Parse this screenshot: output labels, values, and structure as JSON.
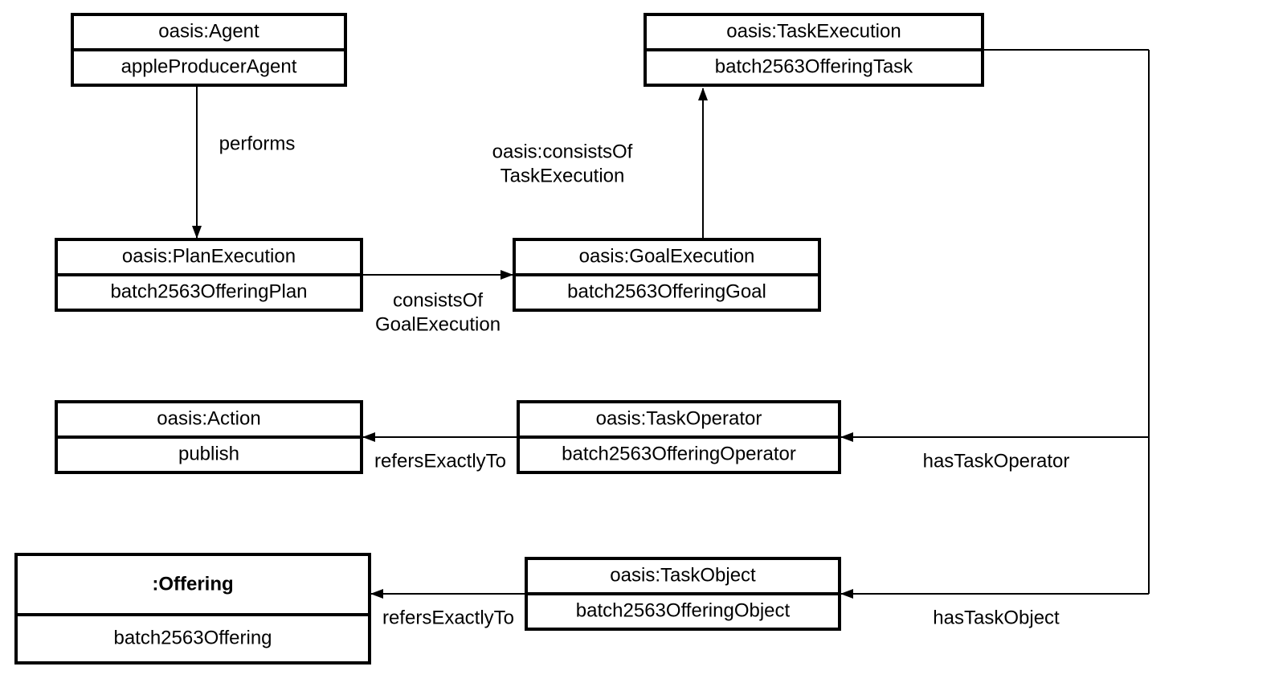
{
  "nodes": {
    "agent": {
      "header": "oasis:Agent",
      "value": "appleProducerAgent"
    },
    "taskExecution": {
      "header": "oasis:TaskExecution",
      "value": "batch2563OfferingTask"
    },
    "planExecution": {
      "header": "oasis:PlanExecution",
      "value": "batch2563OfferingPlan"
    },
    "goalExecution": {
      "header": "oasis:GoalExecution",
      "value": "batch2563OfferingGoal"
    },
    "action": {
      "header": "oasis:Action",
      "value": "publish"
    },
    "taskOperator": {
      "header": "oasis:TaskOperator",
      "value": "batch2563OfferingOperator"
    },
    "offering": {
      "header": ":Offering",
      "value": "batch2563Offering"
    },
    "taskObject": {
      "header": "oasis:TaskObject",
      "value": "batch2563OfferingObject"
    }
  },
  "edges": {
    "performs": "performs",
    "consistsOfGoal1": "consistsOf",
    "consistsOfGoal2": "GoalExecution",
    "consistsOfTask1": "oasis:consistsOf",
    "consistsOfTask2": "TaskExecution",
    "hasTaskOperator": "hasTaskOperator",
    "hasTaskObject": "hasTaskObject",
    "refersExactlyTo1": "refersExactlyTo",
    "refersExactlyTo2": "refersExactlyTo"
  }
}
